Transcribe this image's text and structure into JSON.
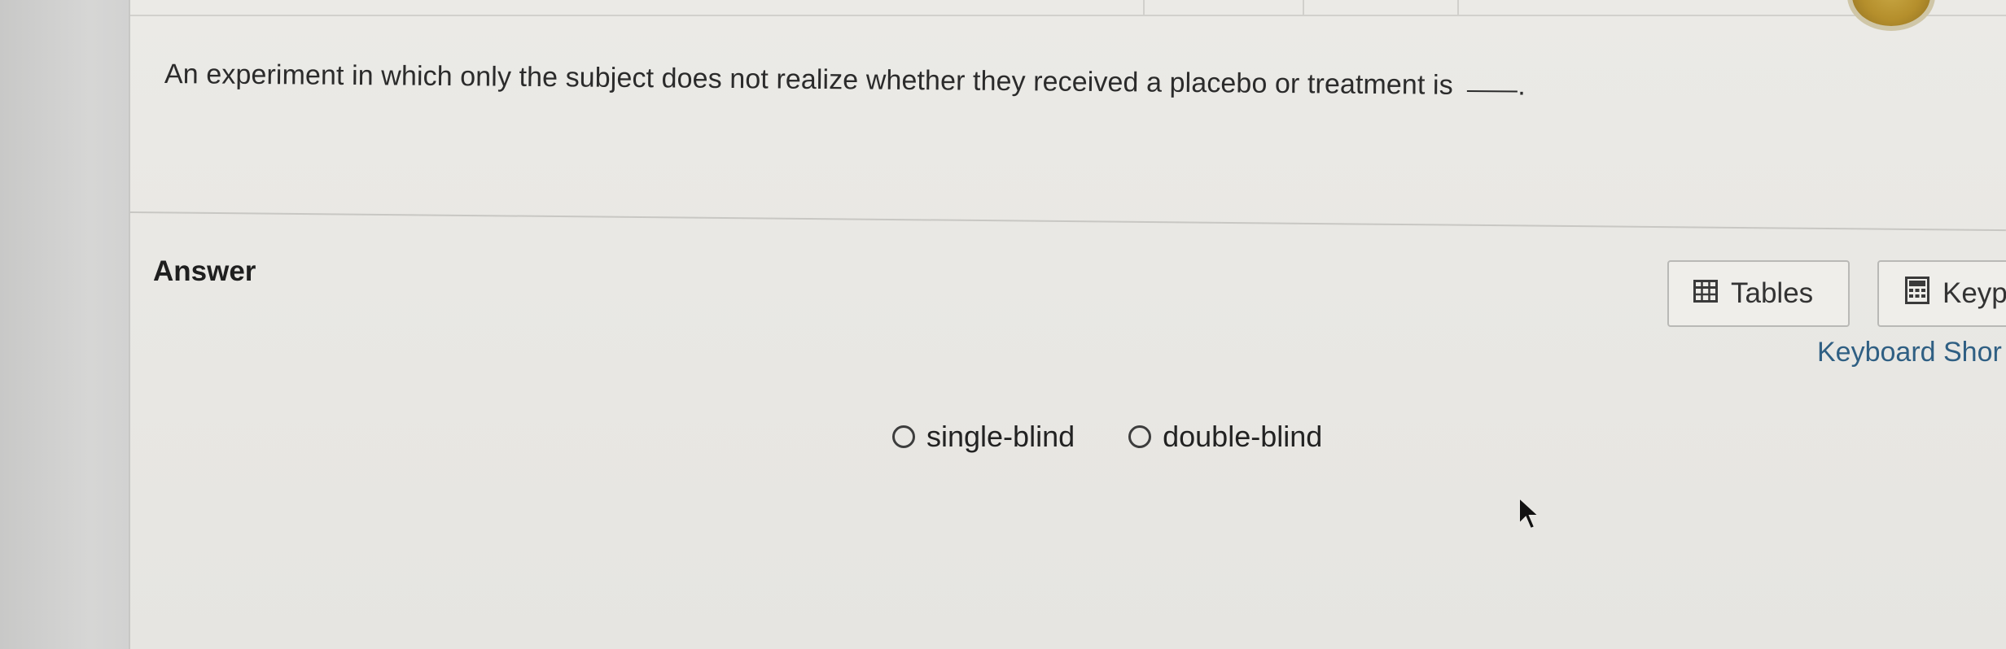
{
  "question": {
    "text": "An experiment in which only the subject does not realize whether they received a placebo or treatment is",
    "end_punctuation": "."
  },
  "answer_label": "Answer",
  "toolbar": {
    "tables_label": "Tables",
    "tables_icon": "table-grid-icon",
    "keypad_label": "Keyp",
    "keypad_icon": "calculator-icon",
    "keyboard_shortcuts_label": "Keyboard Shor"
  },
  "options": [
    {
      "label": "single-blind",
      "selected": false
    },
    {
      "label": "double-blind",
      "selected": false
    }
  ],
  "colors": {
    "text": "#2b2b2b",
    "link": "#2f5f83",
    "border": "#b9b9b6"
  }
}
